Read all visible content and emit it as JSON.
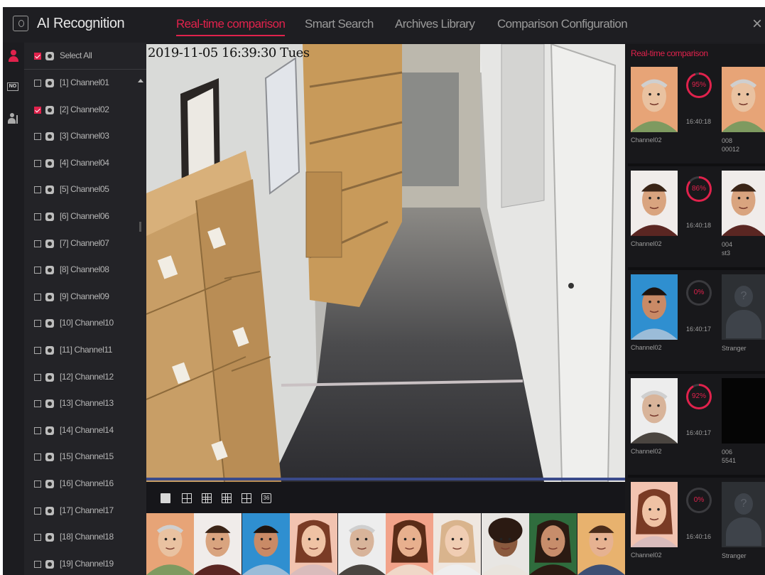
{
  "header": {
    "app_title": "AI Recognition",
    "tabs": [
      {
        "label": "Real-time comparison",
        "active": true
      },
      {
        "label": "Smart Search",
        "active": false
      },
      {
        "label": "Archives Library",
        "active": false
      },
      {
        "label": "Comparison Configuration",
        "active": false
      }
    ],
    "close_label": "×"
  },
  "side_icons": [
    "face-recognition-icon",
    "no-entry-icon",
    "person-count-icon"
  ],
  "channel_list": {
    "select_all_label": "Select All",
    "select_all_checked": true,
    "channels": [
      {
        "label": "[1] Channel01",
        "checked": false
      },
      {
        "label": "[2] Channel02",
        "checked": true
      },
      {
        "label": "[3] Channel03",
        "checked": false
      },
      {
        "label": "[4] Channel04",
        "checked": false
      },
      {
        "label": "[5] Channel05",
        "checked": false
      },
      {
        "label": "[6] Channel06",
        "checked": false
      },
      {
        "label": "[7] Channel07",
        "checked": false
      },
      {
        "label": "[8] Channel08",
        "checked": false
      },
      {
        "label": "[9] Channel09",
        "checked": false
      },
      {
        "label": "[10] Channel10",
        "checked": false
      },
      {
        "label": "[11] Channel11",
        "checked": false
      },
      {
        "label": "[12] Channel12",
        "checked": false
      },
      {
        "label": "[13] Channel13",
        "checked": false
      },
      {
        "label": "[14] Channel14",
        "checked": false
      },
      {
        "label": "[15] Channel15",
        "checked": false
      },
      {
        "label": "[16] Channel16",
        "checked": false
      },
      {
        "label": "[17] Channel17",
        "checked": false
      },
      {
        "label": "[18] Channel18",
        "checked": false
      },
      {
        "label": "[19] Channel19",
        "checked": false
      }
    ]
  },
  "video": {
    "osd_timestamp": "2019-11-05 16:39:30 Tues"
  },
  "layout_buttons": [
    "1",
    "4",
    "9",
    "16",
    "25",
    "36"
  ],
  "layout_36_label": "36",
  "right_panel": {
    "title": "Real-time comparison",
    "matches": [
      {
        "similarity": "95%",
        "time": "16:40:18",
        "channel": "Channel02",
        "id_line1": "008",
        "id_line2": "00012",
        "target": "face"
      },
      {
        "similarity": "86%",
        "time": "16:40:18",
        "channel": "Channel02",
        "id_line1": "004",
        "id_line2": "st3",
        "target": "face"
      },
      {
        "similarity": "0%",
        "time": "16:40:17",
        "channel": "Channel02",
        "id_line1": "Stranger",
        "id_line2": "",
        "target": "stranger"
      },
      {
        "similarity": "92%",
        "time": "16:40:17",
        "channel": "Channel02",
        "id_line1": "006",
        "id_line2": "5541",
        "target": "black"
      },
      {
        "similarity": "0%",
        "time": "16:40:16",
        "channel": "Channel02",
        "id_line1": "Stranger",
        "id_line2": "",
        "target": "stranger"
      }
    ]
  },
  "colors": {
    "accent": "#e0224c",
    "background": "#1c1c20",
    "panel": "#18181b"
  }
}
